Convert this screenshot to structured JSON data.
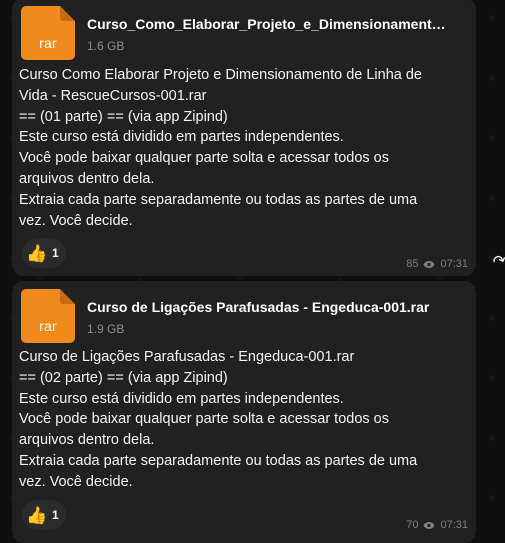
{
  "messages": [
    {
      "file": {
        "extension": "rar",
        "name": "Curso_Como_Elaborar_Projeto_e_Dimensionament…",
        "size": "1.6 GB"
      },
      "caption": "Curso Como Elaborar Projeto e Dimensionamento de Linha de\nVida - RescueCursos-001.rar\n== (01 parte) == (via app Zipind)\nEste curso está dividido em partes independentes.\nVocê pode baixar qualquer parte solta e acessar todos os\narquivos dentro dela.\nExtraia cada parte separadamente ou todas as partes de uma\nvez. Você decide.",
      "reaction": {
        "emoji": "👍",
        "count": "1"
      },
      "views": "85",
      "time": "07:31"
    },
    {
      "file": {
        "extension": "rar",
        "name": "Curso de Ligações Parafusadas - Engeduca-001.rar",
        "size": "1.9 GB"
      },
      "caption": "Curso de Ligações Parafusadas - Engeduca-001.rar\n== (02 parte) == (via app Zipind)\nEste curso está dividido em partes independentes.\nVocê pode baixar qualquer parte solta e acessar todos os\narquivos dentro dela.\nExtraia cada parte separadamente ou todas as partes de uma\nvez. Você decide.",
      "reaction": {
        "emoji": "👍",
        "count": "1"
      },
      "views": "70",
      "time": "07:31"
    }
  ],
  "ui": {
    "file_icon_color": "#f08a1d",
    "bubble_color": "#212121",
    "background_color": "#0f0f0f",
    "side_icon": "forward-arrow-icon"
  }
}
